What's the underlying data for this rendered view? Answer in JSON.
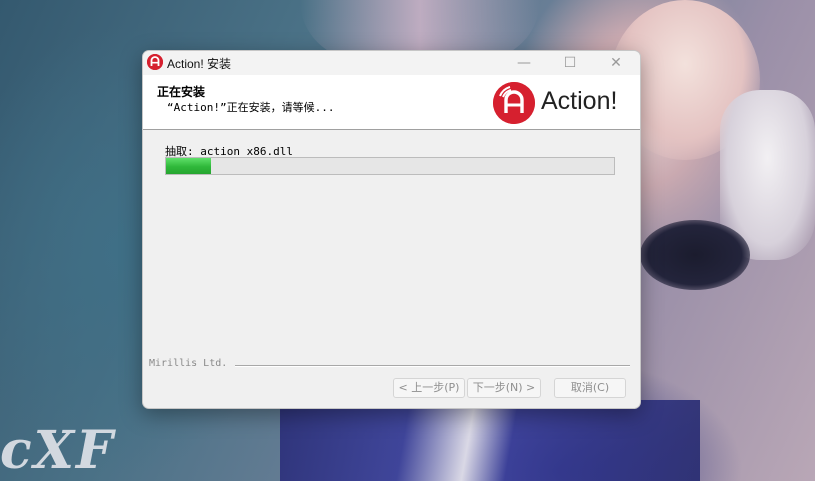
{
  "background": {
    "watermark": "cXF"
  },
  "window": {
    "title": "Action! 安装",
    "title_icon": "action-logo-icon",
    "controls": {
      "minimize": "—",
      "maximize": "☐",
      "close": "✕"
    },
    "header": {
      "title": "正在安装",
      "subtitle": "“Action!”正在安装，请等候..."
    },
    "logo": {
      "text": "Action!",
      "color": "#d6202f"
    },
    "extract_label": "抽取: action_x86.dll",
    "progress": {
      "fraction": 0.1,
      "color": "#2fb83a"
    },
    "brand": "Mirillis Ltd.",
    "buttons": {
      "back": "< 上一步(P)",
      "next": "下一步(N) >",
      "cancel": "取消(C)"
    }
  }
}
